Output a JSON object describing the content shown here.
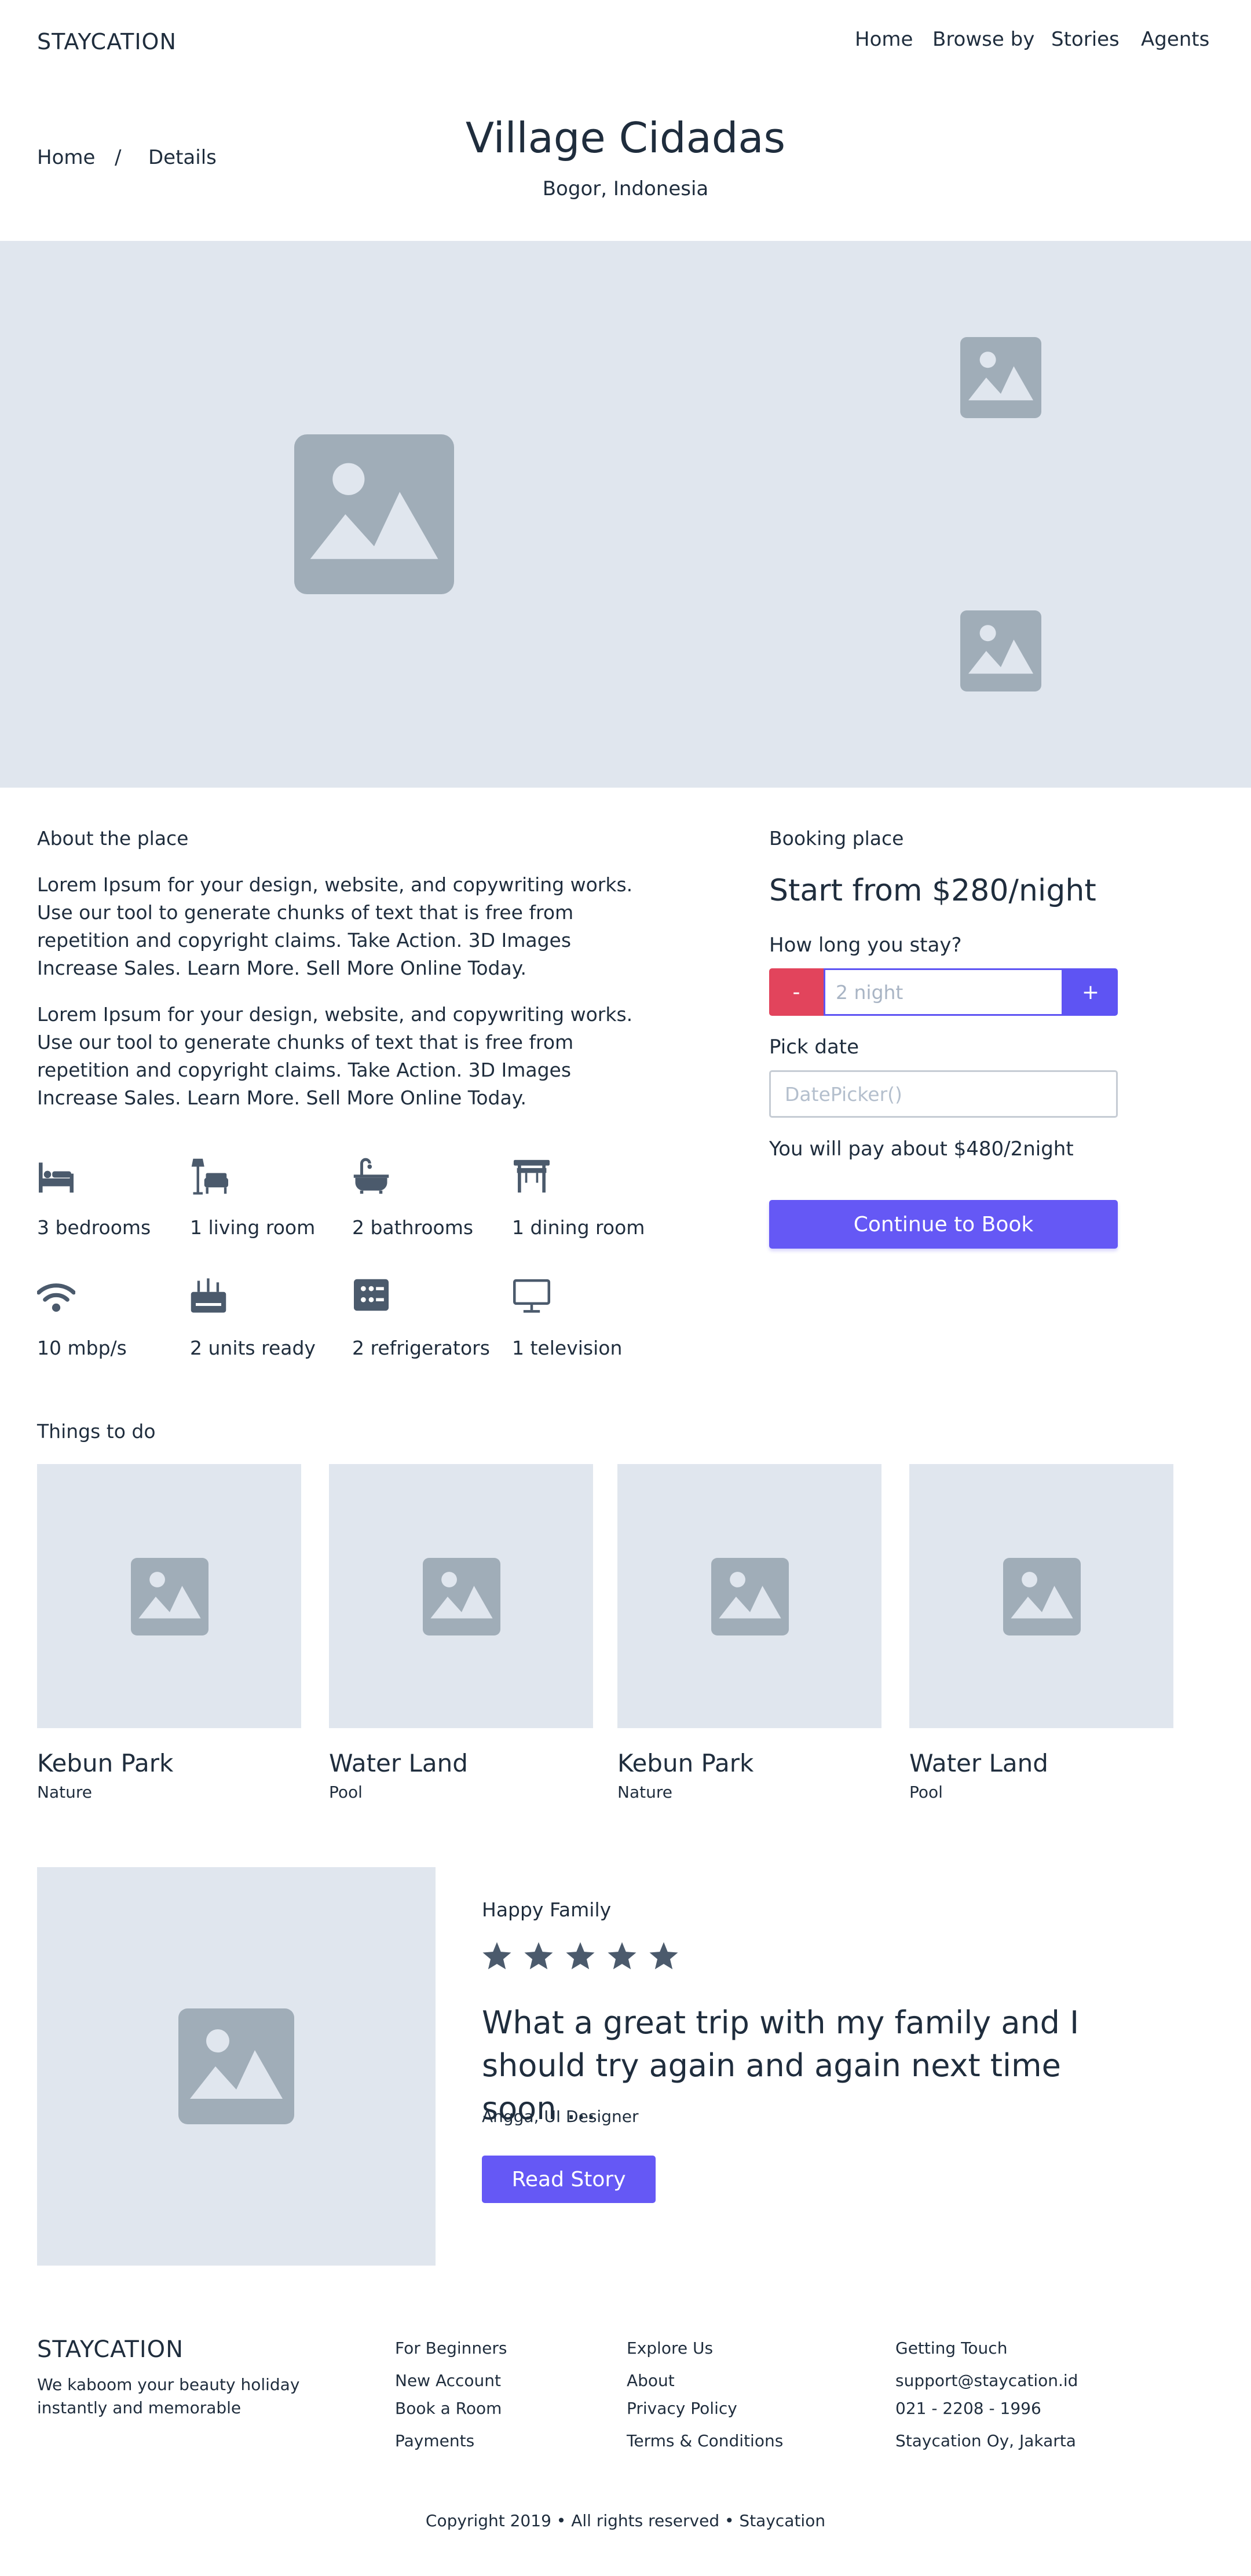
{
  "header": {
    "brand": "STAYCATION",
    "nav": [
      "Home",
      "Browse by",
      "Stories",
      "Agents"
    ]
  },
  "breadcrumb": {
    "home": "Home",
    "separator": "/",
    "current": "Details"
  },
  "page": {
    "title": "Village Cidadas",
    "location": "Bogor, Indonesia"
  },
  "about": {
    "heading": "About the place",
    "paragraphs": [
      "Lorem Ipsum for your design, website, and copywriting works. Use our tool to generate chunks of text that is free from repetition and copyright claims. Take Action. 3D Images Increase Sales. Learn More. Sell More Online Today.",
      "Lorem Ipsum for your design, website, and copywriting works. Use our tool to generate chunks of text that is free from repetition and copyright claims. Take Action. 3D Images Increase Sales. Learn More. Sell More Online Today."
    ],
    "features": [
      {
        "icon": "bed-icon",
        "label": "3 bedrooms"
      },
      {
        "icon": "living-room-icon",
        "label": "1 living room"
      },
      {
        "icon": "bathtub-icon",
        "label": "2 bathrooms"
      },
      {
        "icon": "dining-table-icon",
        "label": "1 dining room"
      },
      {
        "icon": "wifi-icon",
        "label": "10 mbp/s"
      },
      {
        "icon": "ac-unit-icon",
        "label": "2 units ready"
      },
      {
        "icon": "refrigerator-icon",
        "label": "2 refrigerators"
      },
      {
        "icon": "television-icon",
        "label": "1 television"
      }
    ]
  },
  "booking": {
    "heading": "Booking place",
    "price": "Start from $280/night",
    "stay_label": "How long you stay?",
    "minus": "-",
    "plus": "+",
    "night_placeholder": "2 night",
    "date_label": "Pick date",
    "date_placeholder": "DatePicker()",
    "total": "You will pay about $480/2night",
    "cta": "Continue to Book"
  },
  "things": {
    "heading": "Things to do",
    "items": [
      {
        "title": "Kebun Park",
        "category": "Nature"
      },
      {
        "title": "Water Land",
        "category": "Pool"
      },
      {
        "title": "Kebun Park",
        "category": "Nature"
      },
      {
        "title": "Water Land",
        "category": "Pool"
      }
    ]
  },
  "testimonial": {
    "heading": "Happy Family",
    "rating": 5,
    "quote": "What a great trip with my family and I should try again and again next time soon ...",
    "author": "Angga, UI Designer",
    "button": "Read Story"
  },
  "footer": {
    "brand": "STAYCATION",
    "tagline": "We kaboom your beauty holiday instantly and memorable",
    "columns": [
      {
        "heading": "For Beginners",
        "links": [
          "New Account",
          "Book a Room",
          "Payments"
        ]
      },
      {
        "heading": "Explore Us",
        "links": [
          "About",
          "Privacy Policy",
          "Terms & Conditions"
        ]
      },
      {
        "heading": "Getting Touch",
        "links": [
          "support@staycation.id",
          "021 - 2208 - 1996",
          "Staycation Oy, Jakarta"
        ]
      }
    ],
    "copyright": "Copyright 2019 • All rights reserved • Staycation"
  },
  "colors": {
    "primary": "#6558f5",
    "danger": "#e2445c",
    "placeholder_bg": "#e0e6ee",
    "placeholder_icon": "#a0adb8",
    "text": "#1f2d3d",
    "icon": "#4b5a6c"
  }
}
